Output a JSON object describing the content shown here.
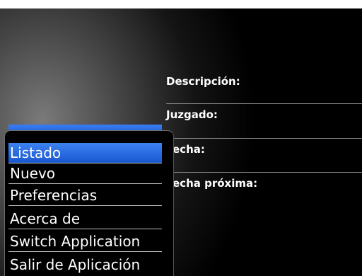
{
  "form": {
    "descripcion_label": "Descripción:",
    "juzgado_label": "Juzgado:",
    "fecha_label": "echa:",
    "fecha_proxima_label": "echa próxima:"
  },
  "menu": {
    "items": [
      {
        "label": "Listado",
        "selected": true
      },
      {
        "label": "Nuevo"
      },
      {
        "label": "Preferencias"
      },
      {
        "label": "Acerca de"
      },
      {
        "label": "Switch Application"
      },
      {
        "label": "Salir de Aplicación"
      }
    ]
  },
  "colors": {
    "selection": "#1a57cf",
    "background": "#000000",
    "text": "#ffffff"
  }
}
